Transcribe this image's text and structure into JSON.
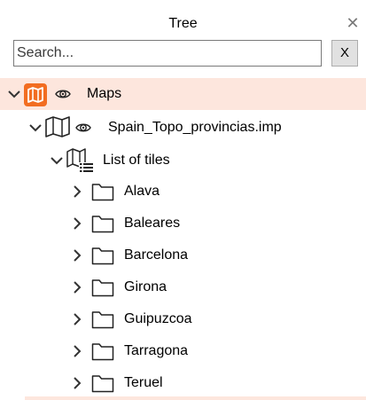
{
  "panel": {
    "title": "Tree",
    "close_glyph": "✕"
  },
  "search": {
    "placeholder": "Search...",
    "value": "",
    "clear_label": "X"
  },
  "tree": {
    "root": {
      "label": "Maps",
      "icon": "map-icon",
      "visibility_icon": "eye-icon",
      "expanded": true,
      "selected": true,
      "accent_color": "#f26d21",
      "highlight_color": "#fde6dd"
    },
    "map_file": {
      "label": "Spain_Topo_provincias.imp",
      "icon": "map-file-icon",
      "visibility_icon": "eye-icon",
      "expanded": true
    },
    "tile_list": {
      "label": "List of tiles",
      "icon": "map-list-icon",
      "expanded": true
    },
    "folders": [
      {
        "label": "Alava"
      },
      {
        "label": "Baleares"
      },
      {
        "label": "Barcelona"
      },
      {
        "label": "Girona"
      },
      {
        "label": "Guipuzcoa"
      },
      {
        "label": "Tarragona"
      },
      {
        "label": "Teruel"
      }
    ]
  }
}
